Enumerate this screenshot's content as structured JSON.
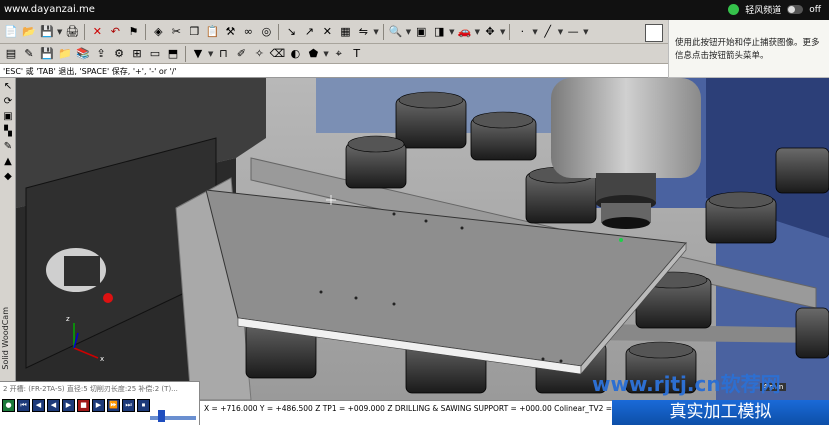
{
  "topbar": {
    "site": "www.dayanzai.me",
    "channel": "轻风频道",
    "toggle_state": "off"
  },
  "hint": {
    "text": "使用此按钮开始和停止捕获图像。更多信息点击按钮箭头菜单。"
  },
  "status_line": "'ESC' 或 'TAB' 退出, 'SPACE' 保存, '+', '-' or '/'",
  "vertical_label": "Solid  WoodCam",
  "bottom_panel": {
    "info": "2 开槽: (FR-2TA-S) 直径:5 切削刃长度:25 补偿:2 (T)...",
    "controls": [
      "record",
      "rewind",
      "back",
      "play",
      "stop",
      "step",
      "forward",
      "fast-forward",
      "end",
      "loop"
    ]
  },
  "coords": "X = +716.000  Y = +486.500  Z TP1 = +009.000  Z DRILLING & SAWING SUPPORT = +000.00  Colinear_TV2 = +100.000  Z TH7&8 = +000...",
  "watermark": {
    "url": "www.rjtj.cn软荐网",
    "banner": "真实加工模拟",
    "scale": "4 mm"
  },
  "colors": {
    "toolbar_bg": "#d6d3ce",
    "viewport_bg": "#c2c2c2",
    "accent_blue": "#2d6fd1"
  }
}
